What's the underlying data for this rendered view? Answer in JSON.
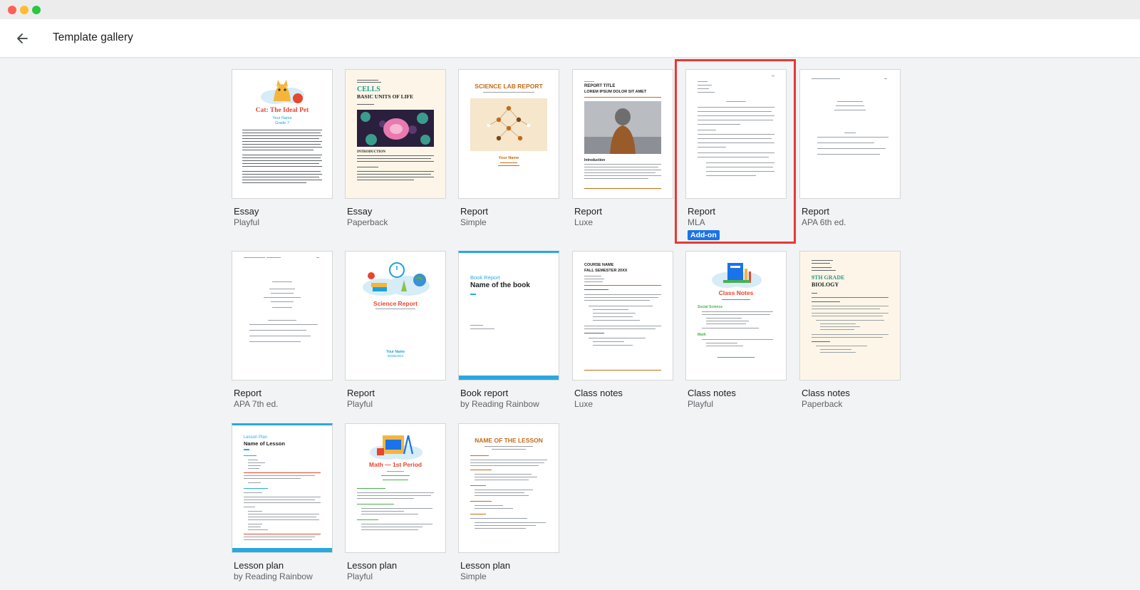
{
  "window": {
    "traffic_lights": [
      "close",
      "minimize",
      "zoom"
    ]
  },
  "header": {
    "back_icon": "arrow-left-icon",
    "title": "Template gallery"
  },
  "templates": [
    {
      "title": "Essay",
      "subtitle": "Playful",
      "thumb": {
        "heading": "Cat: The Ideal Pet",
        "line1": "Your Name",
        "line2": "Grade 7"
      }
    },
    {
      "title": "Essay",
      "subtitle": "Paperback",
      "thumb": {
        "heading1": "CELLS",
        "heading2": "BASIC UNITS OF LIFE",
        "section": "INTRODUCTION"
      }
    },
    {
      "title": "Report",
      "subtitle": "Simple",
      "thumb": {
        "heading": "SCIENCE LAB REPORT",
        "name": "Your Name"
      }
    },
    {
      "title": "Report",
      "subtitle": "Luxe",
      "thumb": {
        "heading1": "REPORT TITLE",
        "heading2": "LOREM IPSUM DOLOR SIT AMET",
        "section": "Introduction"
      }
    },
    {
      "title": "Report",
      "subtitle": "MLA",
      "badge": "Add-on"
    },
    {
      "title": "Report",
      "subtitle": "APA 6th ed."
    },
    {
      "title": "Report",
      "subtitle": "APA 7th ed."
    },
    {
      "title": "Report",
      "subtitle": "Playful",
      "thumb": {
        "heading": "Science Report",
        "name": "Your Name",
        "date": "06/06/2024"
      }
    },
    {
      "title": "Book report",
      "subtitle": "by Reading Rainbow",
      "thumb": {
        "label": "Book Report",
        "heading": "Name of the book"
      }
    },
    {
      "title": "Class notes",
      "subtitle": "Luxe",
      "thumb": {
        "heading1": "COURSE NAME",
        "heading2": "FALL SEMESTER 20XX"
      }
    },
    {
      "title": "Class notes",
      "subtitle": "Playful",
      "thumb": {
        "heading": "Class Notes",
        "section1": "Social Science",
        "section2": "Math"
      }
    },
    {
      "title": "Class notes",
      "subtitle": "Paperback",
      "thumb": {
        "heading1": "9TH GRADE",
        "heading2": "BIOLOGY"
      }
    },
    {
      "title": "Lesson plan",
      "subtitle": "by Reading Rainbow",
      "thumb": {
        "label": "Lesson Plan",
        "heading": "Name of Lesson"
      }
    },
    {
      "title": "Lesson plan",
      "subtitle": "Playful",
      "thumb": {
        "heading": "Math — 1st Period"
      }
    },
    {
      "title": "Lesson plan",
      "subtitle": "Simple",
      "thumb": {
        "heading": "NAME OF THE LESSON"
      }
    }
  ],
  "colors": {
    "highlight": "#e53935",
    "badge": "#1a73e8",
    "header_bg": "#ffffff",
    "gallery_bg": "#f1f3f4"
  }
}
